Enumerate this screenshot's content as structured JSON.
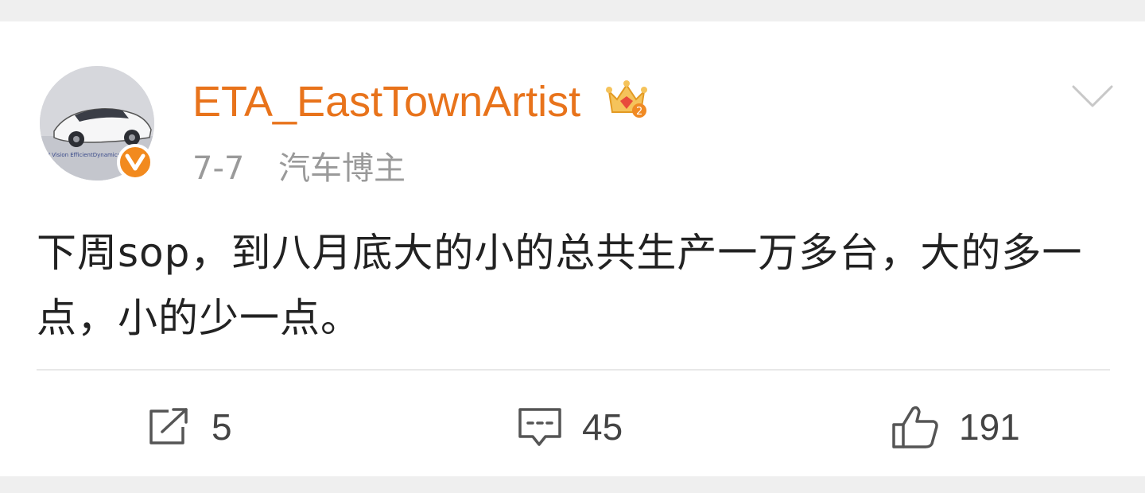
{
  "post": {
    "username": "ETA_EastTownArtist",
    "date": "7-7",
    "author_tag": "汽车博主",
    "text": "下周sop，到八月底大的小的总共生产一万多台，大的多一点，小的少一点。",
    "avatar_caption": "W Vision EfficientDynamics",
    "badges": {
      "verified_icon": "verified-v-icon",
      "crown_icon": "crown-level-icon"
    }
  },
  "actions": {
    "repost": {
      "icon": "repost-icon",
      "count": "5"
    },
    "comment": {
      "icon": "comment-icon",
      "count": "45"
    },
    "like": {
      "icon": "like-icon",
      "count": "191"
    }
  },
  "colors": {
    "username": "#e8731b",
    "meta": "#9a9a9a",
    "text": "#222222",
    "verified_badge": "#f28a1e",
    "background": "#efefef"
  }
}
